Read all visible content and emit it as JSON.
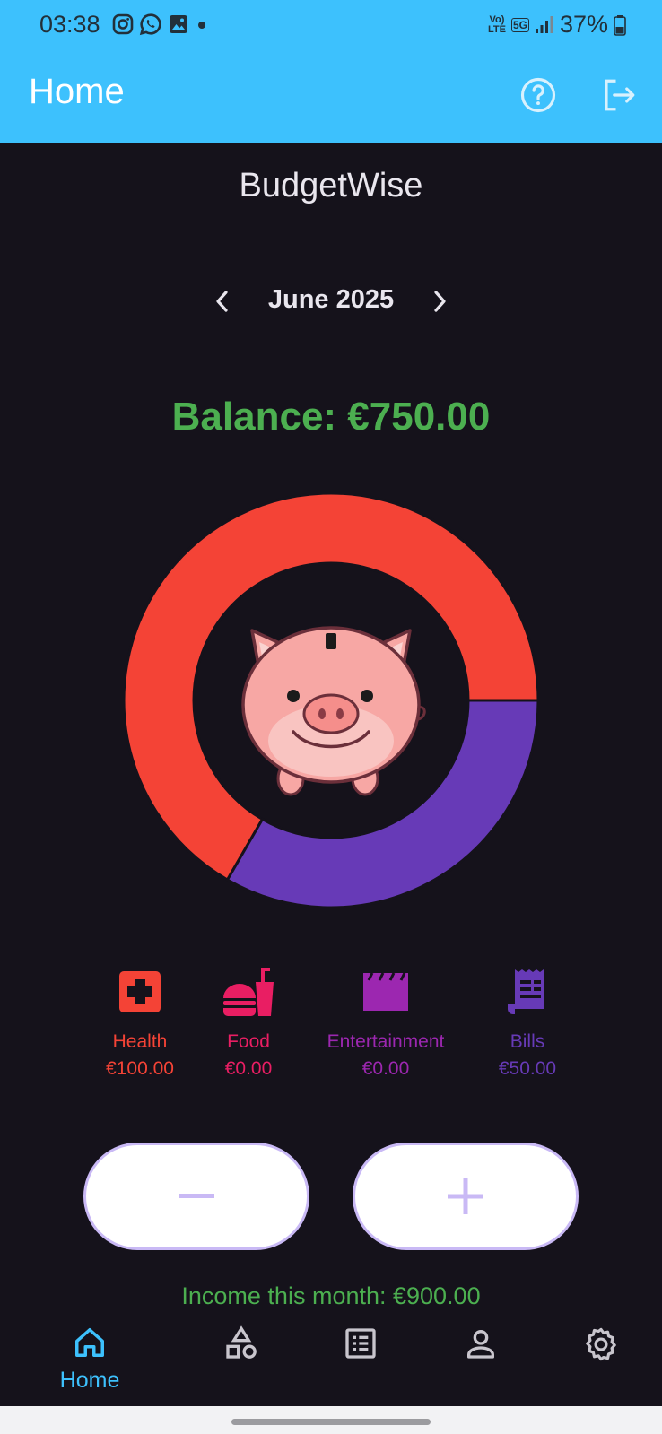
{
  "status_bar": {
    "time": "03:38",
    "battery": "37%",
    "network": "5G",
    "carrier_tag": "Vo) LTE"
  },
  "app_bar": {
    "title": "Home",
    "help_icon": "help-circle-icon",
    "logout_icon": "logout-icon",
    "color": "#3dc1fd"
  },
  "main": {
    "app_name": "BudgetWise",
    "month": "June 2025",
    "balance": "Balance: €750.00",
    "income": "Income this month: €900.00"
  },
  "chart_data": {
    "type": "pie",
    "style": "donut",
    "categories": [
      "Health",
      "Bills"
    ],
    "values": [
      100,
      50
    ],
    "colors": [
      "#f44336",
      "#673ab7"
    ],
    "center_image": "piggy-bank"
  },
  "categories": [
    {
      "name": "Health",
      "amount": "€100.00",
      "icon": "medical-cross-icon",
      "color": "#f44336"
    },
    {
      "name": "Food",
      "amount": "€0.00",
      "icon": "fastfood-icon",
      "color": "#e91e63"
    },
    {
      "name": "Entertainment",
      "amount": "€0.00",
      "icon": "clapperboard-icon",
      "color": "#9c27b0"
    },
    {
      "name": "Bills",
      "amount": "€50.00",
      "icon": "receipt-icon",
      "color": "#673ab7"
    }
  ],
  "actions": {
    "remove_icon": "minus-icon",
    "add_icon": "plus-icon"
  },
  "bottom_nav": {
    "items": [
      {
        "label": "Home",
        "icon": "home-icon",
        "active": true
      },
      {
        "label": "",
        "icon": "shapes-icon",
        "active": false
      },
      {
        "label": "",
        "icon": "list-icon",
        "active": false
      },
      {
        "label": "",
        "icon": "person-icon",
        "active": false
      },
      {
        "label": "",
        "icon": "gear-icon",
        "active": false
      }
    ]
  }
}
